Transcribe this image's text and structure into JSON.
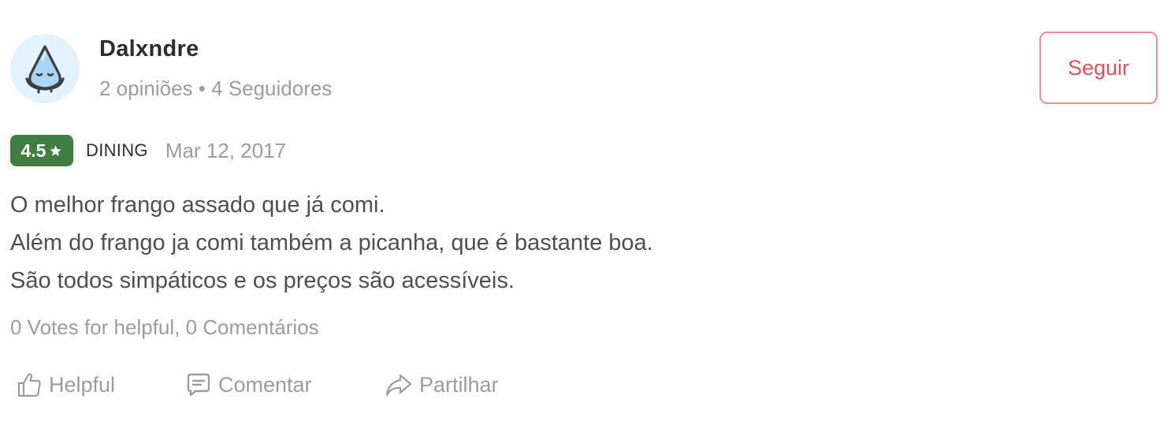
{
  "reviewer": {
    "avatar_icon": "water-drop-icon",
    "name": "Dalxndre",
    "reviews_count": "2 opiniões",
    "separator": "•",
    "followers": "4 Seguidores",
    "meta_line": "2 opiniões • 4 Seguidores"
  },
  "follow_button": {
    "label": "Seguir",
    "color": "#e0505c"
  },
  "review": {
    "rating": "4.5",
    "rating_color": "#3f7e41",
    "type": "DINING",
    "date": "Mar 12, 2017",
    "lines": [
      "O melhor frango assado que já comi.",
      "Além do frango ja comi também a picanha, que é bastante boa.",
      "São todos simpáticos e os preços são acessíveis."
    ],
    "stats": "0 Votes for helpful, 0 Comentários"
  },
  "actions": {
    "helpful": {
      "label": "Helpful",
      "icon": "thumbs-up-icon"
    },
    "comment": {
      "label": "Comentar",
      "icon": "comment-icon"
    },
    "share": {
      "label": "Partilhar",
      "icon": "share-icon"
    }
  }
}
